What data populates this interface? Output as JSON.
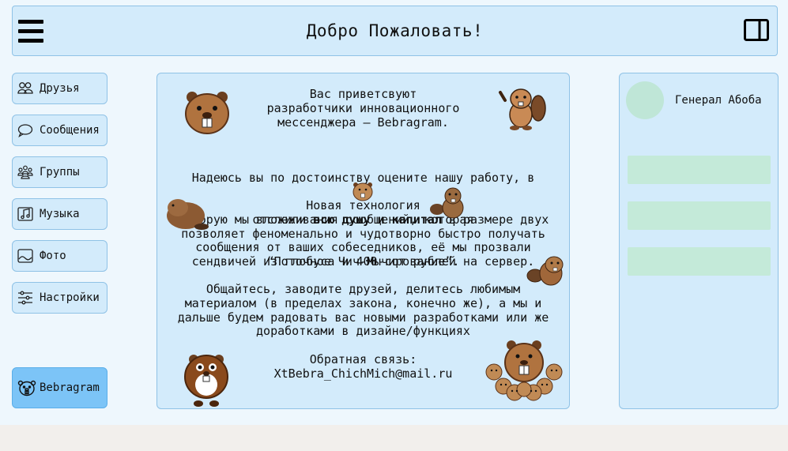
{
  "header": {
    "title": "Добро Пожаловать!",
    "menu_icon": "hamburger-menu-icon",
    "panel_icon": "side-panel-icon"
  },
  "sidebar": {
    "items": [
      {
        "label": "Друзья",
        "icon": "friends-icon"
      },
      {
        "label": "Сообщения",
        "icon": "chat-bubble-icon"
      },
      {
        "label": "Группы",
        "icon": "groups-icon"
      },
      {
        "label": "Музыка",
        "icon": "music-note-icon"
      },
      {
        "label": "Фото",
        "icon": "photo-icon"
      },
      {
        "label": "Настройки",
        "icon": "sliders-icon"
      }
    ],
    "brand": {
      "label": "Bebragram",
      "icon": "beaver-logo-icon"
    }
  },
  "main": {
    "intro": "Вас приветсвуют\nразработчики инновационного\nмессенджера – Bebragram.",
    "p2_line1": "Надеюсь вы по достоинству оцените нашу работу, в",
    "p2_line2_a": "которую мы вложили ",
    "p2_line2_bold": "всю душу и капитал",
    "p2_line2_b": " в размере двух",
    "p2_line3": "сендвичей из глобуса и 400-сот рублей на сервер.",
    "p3": "Новая технология\nотслеживания сообщений, которая\nпозволяет феноменально и чудотворно быстро получать\nсообщения от ваших собеседников, её мы прозвали\n“Поточное Чич-Мычирование”.",
    "p4": "Общайтесь, заводите друзей, делитесь любимым\nматериалом (в пределах закона, конечно же), а мы и\nдальше будем радовать вас новыми разработками или же\nдоработками в дизайне/функциях",
    "feedback_label": "Обратная связь:",
    "feedback_email": "XtBebra_ChichMich@mail.ru"
  },
  "profile": {
    "name": "Генерал Абоба"
  },
  "colors": {
    "panel": "#d3ebfb",
    "border": "#8fc2e6",
    "brand": "#7cc4f7",
    "placeholder": "#c4ead9",
    "beaver_brown": "#a0673a"
  }
}
